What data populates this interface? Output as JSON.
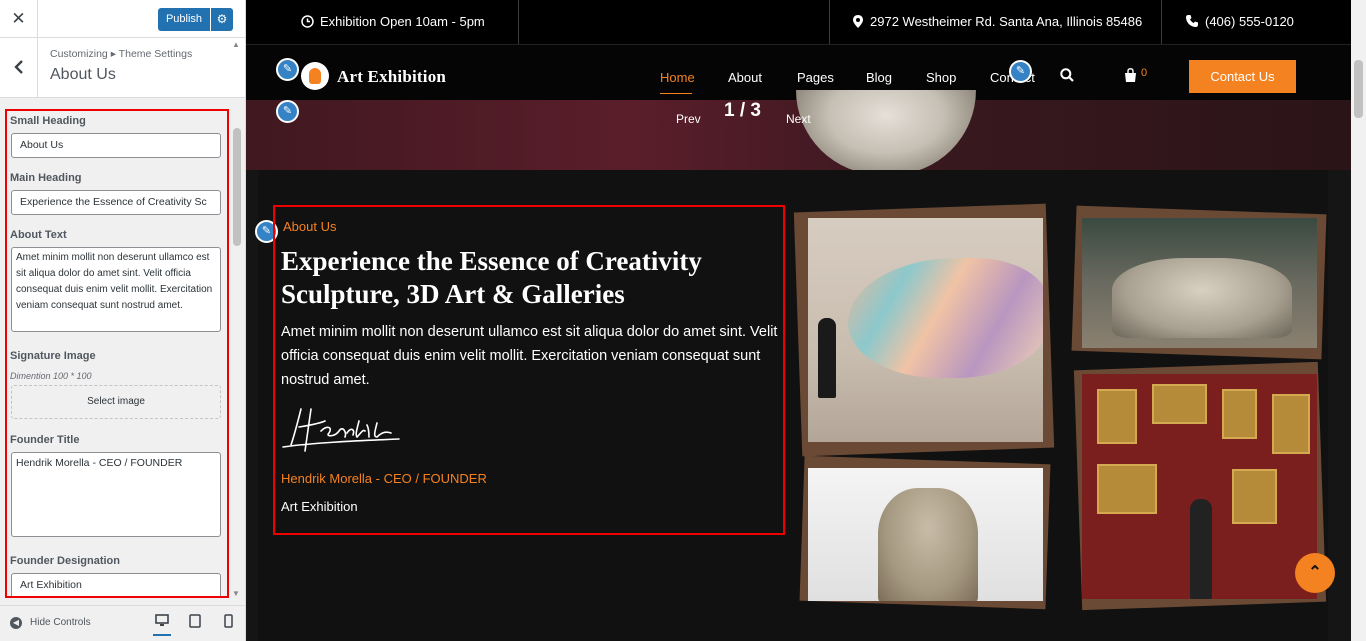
{
  "customizer": {
    "close_icon": "close-icon",
    "publish_label": "Publish",
    "breadcrumb": "Customizing ▸ Theme Settings",
    "section_title": "About Us",
    "fields": {
      "small_heading_label": "Small Heading",
      "small_heading_value": "About Us",
      "main_heading_label": "Main Heading",
      "main_heading_value": "Experience the Essence of Creativity  Sc",
      "about_text_label": "About Text",
      "about_text_value": "Amet minim mollit non deserunt ullamco est sit aliqua dolor do amet sint. Velit officia consequat duis enim velit mollit. Exercitation veniam consequat sunt nostrud amet.",
      "signature_label": "Signature Image",
      "signature_note": "Dimention 100 * 100",
      "select_image_label": "Select image",
      "founder_title_label": "Founder Title",
      "founder_title_value": "Hendrik Morella - CEO / FOUNDER",
      "founder_designation_label": "Founder Designation",
      "founder_designation_value": "Art Exhibition"
    },
    "hide_controls_label": "Hide Controls"
  },
  "site": {
    "topbar": {
      "hours": "Exhibition Open 10am - 5pm",
      "address": "2972 Westheimer Rd. Santa Ana, Illinois 85486",
      "phone": "(406) 555-0120"
    },
    "brand": "Art Exhibition",
    "nav": [
      "Home",
      "About",
      "Pages",
      "Blog",
      "Shop",
      "Contact"
    ],
    "cart_count": "0",
    "contact_button": "Contact Us",
    "slider": {
      "page": "1 / 3",
      "prev": "Prev",
      "next": "Next"
    },
    "about": {
      "small_heading": "About Us",
      "main_heading": "Experience the Essence of Creativity Sculpture, 3D Art & Galleries",
      "text": "Amet minim mollit non deserunt ullamco est sit aliqua dolor do amet sint. Velit officia consequat duis enim velit mollit. Exercitation veniam consequat sunt nostrud amet.",
      "signature": "Hendrik",
      "founder_title": "Hendrik Morella - CEO / FOUNDER",
      "founder_designation": "Art Exhibition"
    }
  },
  "colors": {
    "accent": "#f58220",
    "wp_blue": "#2271b1",
    "highlight_border": "#ee0000",
    "site_bg": "#151515"
  }
}
